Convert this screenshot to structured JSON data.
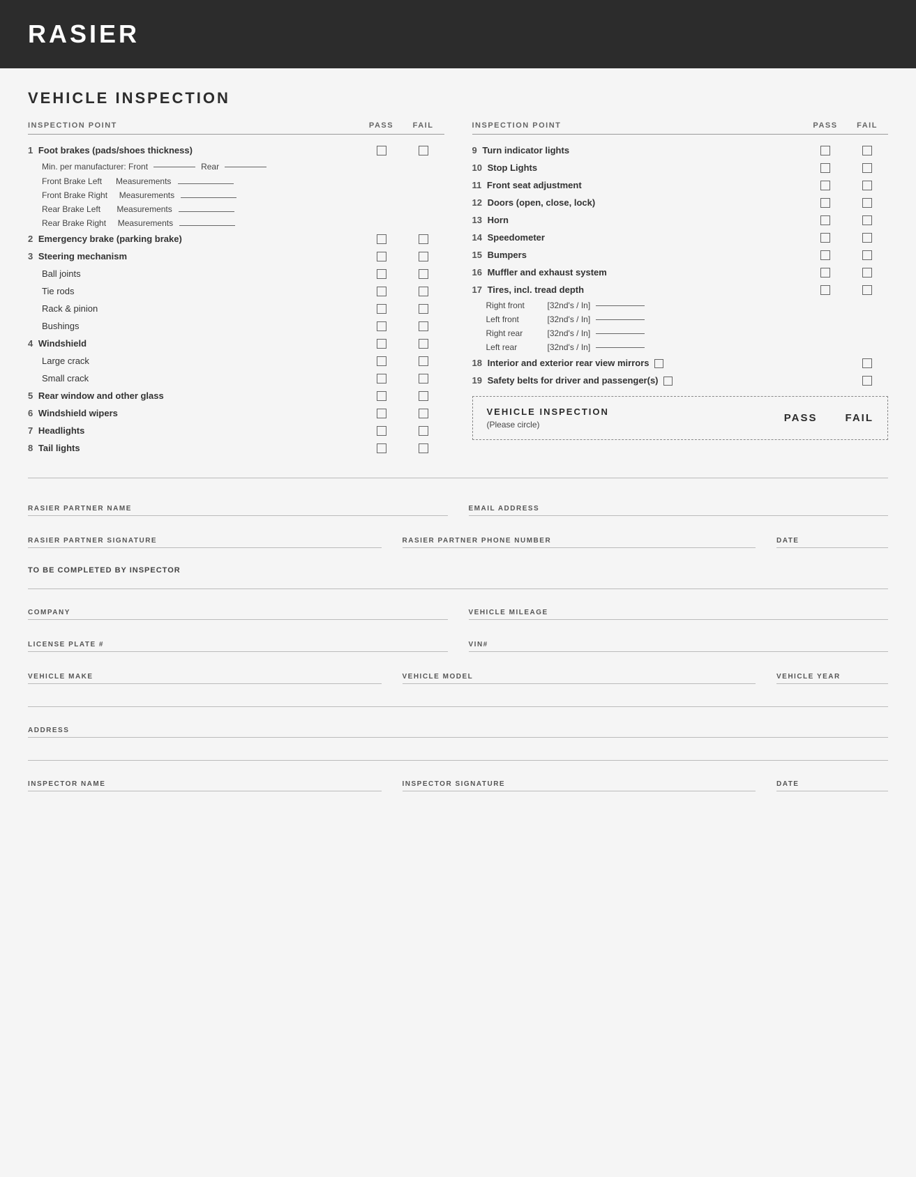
{
  "header": {
    "title": "RASIER"
  },
  "page": {
    "section_title": "VEHICLE INSPECTION"
  },
  "left_column": {
    "header": {
      "label": "INSPECTION POINT",
      "pass": "PASS",
      "fail": "FAIL"
    },
    "items": [
      {
        "number": "1",
        "label": "Foot brakes (pads/shoes thickness)",
        "bold": true,
        "has_checkbox": true,
        "sub": [
          {
            "type": "min_per",
            "front_label": "Min. per manufacturer:  Front",
            "rear_label": "Rear"
          },
          {
            "type": "measurement",
            "label": "Front Brake Left",
            "meas": "Measurements"
          },
          {
            "type": "measurement",
            "label": "Front Brake Right",
            "meas": "Measurements"
          },
          {
            "type": "measurement",
            "label": "Rear Brake Left",
            "meas": "Measurements"
          },
          {
            "type": "measurement",
            "label": "Rear Brake Right",
            "meas": "Measurements"
          }
        ]
      },
      {
        "number": "2",
        "label": "Emergency brake (parking brake)",
        "bold": true,
        "has_checkbox": true
      },
      {
        "number": "3",
        "label": "Steering mechanism",
        "bold": true,
        "has_checkbox": true,
        "sub": [
          {
            "type": "checkbox_item",
            "label": "Ball joints"
          },
          {
            "type": "checkbox_item",
            "label": "Tie rods"
          },
          {
            "type": "checkbox_item",
            "label": "Rack & pinion"
          },
          {
            "type": "checkbox_item",
            "label": "Bushings"
          }
        ]
      },
      {
        "number": "4",
        "label": "Windshield",
        "bold": true,
        "has_checkbox": true,
        "sub": [
          {
            "type": "checkbox_item",
            "label": "Large crack"
          },
          {
            "type": "checkbox_item",
            "label": "Small crack"
          }
        ]
      },
      {
        "number": "5",
        "label": "Rear window and other glass",
        "bold": true,
        "has_checkbox": true
      },
      {
        "number": "6",
        "label": "Windshield wipers",
        "bold": true,
        "has_checkbox": true
      },
      {
        "number": "7",
        "label": "Headlights",
        "bold": true,
        "has_checkbox": true
      },
      {
        "number": "8",
        "label": "Tail lights",
        "bold": true,
        "has_checkbox": true
      }
    ]
  },
  "right_column": {
    "header": {
      "label": "INSPECTION POINT",
      "pass": "PASS",
      "fail": "FAIL"
    },
    "items": [
      {
        "number": "9",
        "label": "Turn indicator lights",
        "bold": true,
        "has_checkbox": true
      },
      {
        "number": "10",
        "label": "Stop Lights",
        "bold": true,
        "has_checkbox": true
      },
      {
        "number": "11",
        "label": "Front seat adjustment",
        "bold": true,
        "has_checkbox": true
      },
      {
        "number": "12",
        "label": "Doors (open, close, lock)",
        "bold": true,
        "has_checkbox": true
      },
      {
        "number": "13",
        "label": "Horn",
        "bold": true,
        "has_checkbox": true
      },
      {
        "number": "14",
        "label": "Speedometer",
        "bold": true,
        "has_checkbox": true
      },
      {
        "number": "15",
        "label": "Bumpers",
        "bold": true,
        "has_checkbox": true
      },
      {
        "number": "16",
        "label": "Muffler and exhaust system",
        "bold": true,
        "has_checkbox": true
      },
      {
        "number": "17",
        "label": "Tires, incl. tread depth",
        "bold": true,
        "has_checkbox": true,
        "sub": [
          {
            "type": "tire",
            "label": "Right front",
            "unit": "[32nd's / In]"
          },
          {
            "type": "tire",
            "label": "Left front",
            "unit": "[32nd's / In]"
          },
          {
            "type": "tire",
            "label": "Right rear",
            "unit": "[32nd's / In]"
          },
          {
            "type": "tire",
            "label": "Left rear",
            "unit": "[32nd's / In]"
          }
        ]
      },
      {
        "number": "18",
        "label": "Interior and exterior rear view mirrors",
        "bold": true,
        "has_checkbox": true
      },
      {
        "number": "19",
        "label": "Safety belts for driver and passenger(s)",
        "bold": true,
        "has_checkbox": true
      }
    ],
    "dashed_box": {
      "title": "VEHICLE INSPECTION",
      "subtitle": "(Please circle)",
      "pass_label": "PASS",
      "fail_label": "FAIL"
    }
  },
  "form": {
    "to_be_completed": "TO BE COMPLETED BY INSPECTOR",
    "fields": [
      {
        "id": "partner-name",
        "label": "RASIER PARTNER NAME",
        "col": 1
      },
      {
        "id": "email",
        "label": "EMAIL ADDRESS",
        "col": 2
      },
      {
        "id": "signature",
        "label": "RASIER PARTNER SIGNATURE",
        "col": 1
      },
      {
        "id": "phone",
        "label": "RASIER PARTNER PHONE NUMBER",
        "col": 2
      },
      {
        "id": "date1",
        "label": "DATE",
        "col": 3
      },
      {
        "id": "company",
        "label": "COMPANY",
        "col": 1
      },
      {
        "id": "mileage",
        "label": "VEHICLE MILEAGE",
        "col": 2
      },
      {
        "id": "license",
        "label": "LICENSE PLATE #",
        "col": 1
      },
      {
        "id": "vin",
        "label": "VIN#",
        "col": 2
      },
      {
        "id": "make",
        "label": "VEHICLE MAKE",
        "col": 1
      },
      {
        "id": "model",
        "label": "VEHICLE MODEL",
        "col": 2
      },
      {
        "id": "year",
        "label": "VEHICLE YEAR",
        "col": 3
      },
      {
        "id": "address",
        "label": "ADDRESS",
        "col": 1
      },
      {
        "id": "inspector-name",
        "label": "INSPECTOR NAME",
        "col": 1
      },
      {
        "id": "inspector-sig",
        "label": "INSPECTOR SIGNATURE",
        "col": 2
      },
      {
        "id": "date2",
        "label": "DATE",
        "col": 3
      }
    ]
  }
}
